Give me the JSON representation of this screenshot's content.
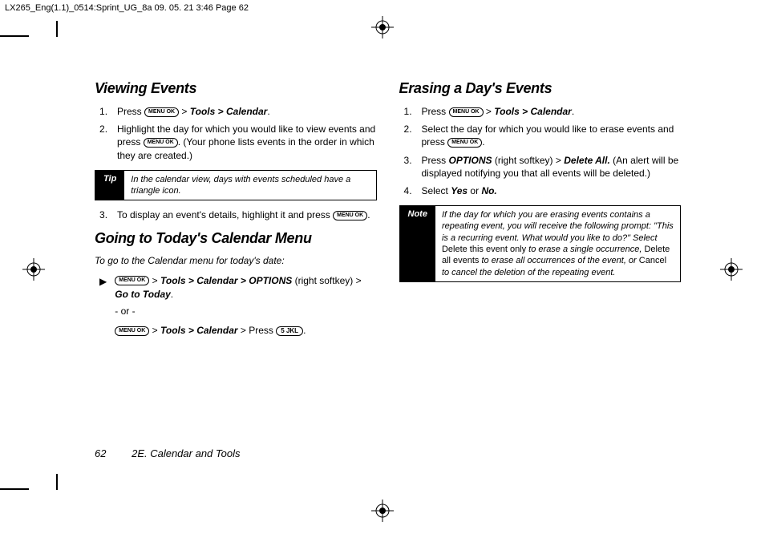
{
  "header_slug": "LX265_Eng(1.1)_0514:Sprint_UG_8a  09. 05. 21    3:46  Page 62",
  "left": {
    "h1": "Viewing Events",
    "li1_a": "Press ",
    "li1_key": "MENU OK",
    "li1_b": " > ",
    "li1_path": "Tools > Calendar",
    "li1_end": ".",
    "li2_a": "Highlight the day for which you would like to view events and press ",
    "li2_key": "MENU OK",
    "li2_b": ". (Your phone lists events in the order in which they are created.)",
    "tip_label": "Tip",
    "tip_text": "In the calendar view, days with events scheduled have a triangle icon.",
    "li3_a": "To display an event's details, highlight it and press ",
    "li3_key": "MENU OK",
    "li3_b": ".",
    "h2": "Going to Today's Calendar Menu",
    "intro": "To go to the Calendar menu for today's date:",
    "arrow_key": "MENU OK",
    "arrow_path1": "Tools > Calendar > OPTIONS",
    "arrow_mid": " (right softkey) > ",
    "arrow_path2": "Go to Today",
    "arrow_end": ".",
    "or": "- or -",
    "alt_key": "MENU OK",
    "alt_path": "Tools > Calendar",
    "alt_mid": " > Press ",
    "alt_key2": "5 JKL",
    "alt_end": "."
  },
  "right": {
    "h1": "Erasing a Day's Events",
    "li1_a": "Press ",
    "li1_key": "MENU OK",
    "li1_b": " > ",
    "li1_path": "Tools > Calendar",
    "li1_end": ".",
    "li2_a": "Select the day for which you would like to erase events and press ",
    "li2_key": "MENU OK",
    "li2_b": ".",
    "li3_a": "Press ",
    "li3_opt": "OPTIONS",
    "li3_b": " (right softkey) > ",
    "li3_del": "Delete All.",
    "li3_c": " (An alert will be displayed notifying you that all events will be deleted.)",
    "li4_a": "Select ",
    "li4_yes": "Yes",
    "li4_or": " or ",
    "li4_no": "No.",
    "note_label": "Note",
    "note_a": "If the day for which you are erasing events contains a repeating event, you will receive the following prompt: \"This is a recurring event. What would you like to do?\" Select ",
    "note_b": "Delete this event only",
    "note_c": " to erase a single occurrence, ",
    "note_d": "Delete all events",
    "note_e": " to erase all occurrences of the event, or ",
    "note_f": "Cancel",
    "note_g": " to cancel the deletion of the repeating event."
  },
  "footer": {
    "page": "62",
    "section": "2E. Calendar and Tools"
  }
}
